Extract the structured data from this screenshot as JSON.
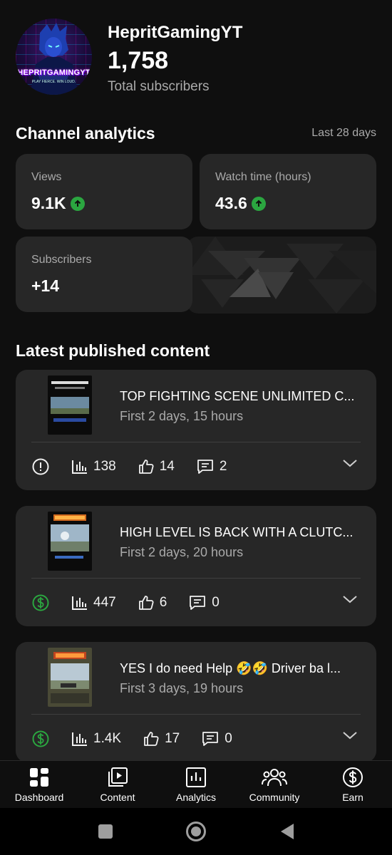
{
  "channel": {
    "avatar_text": "HEPRITGAMINGYT",
    "avatar_tagline": "PLAY FIERCE. WIN LOUD.",
    "name": "HepritGamingYT",
    "subscribers": "1,758",
    "subscribers_label": "Total subscribers"
  },
  "analytics": {
    "title": "Channel analytics",
    "period": "Last 28 days",
    "cards": [
      {
        "label": "Views",
        "value": "9.1K",
        "trend": "up"
      },
      {
        "label": "Watch time (hours)",
        "value": "43.6",
        "trend": "up"
      },
      {
        "label": "Subscribers",
        "value": "+14"
      }
    ]
  },
  "latest": {
    "title": "Latest published content",
    "videos": [
      {
        "title": "TOP FIGHTING SCENE UNLIMITED C...",
        "meta": "First 2 days, 15 hours",
        "status_icon": "alert-icon",
        "views": "138",
        "likes": "14",
        "comments": "2"
      },
      {
        "title": "HIGH LEVEL IS BACK WITH A CLUTC...",
        "meta": "First 2 days, 20 hours",
        "status_icon": "monetized-icon",
        "views": "447",
        "likes": "6",
        "comments": "0"
      },
      {
        "title": "YES I do need Help 🤣🤣 Driver ba l...",
        "meta": "First 3 days, 19 hours",
        "status_icon": "monetized-icon",
        "views": "1.4K",
        "likes": "17",
        "comments": "0"
      }
    ]
  },
  "nav": {
    "items": [
      {
        "label": "Dashboard",
        "icon": "dashboard-icon"
      },
      {
        "label": "Content",
        "icon": "content-icon"
      },
      {
        "label": "Analytics",
        "icon": "analytics-icon"
      },
      {
        "label": "Community",
        "icon": "community-icon"
      },
      {
        "label": "Earn",
        "icon": "earn-icon"
      }
    ]
  },
  "colors": {
    "background": "#0f0f0f",
    "card": "#272727",
    "trend_up": "#2ba640",
    "monetized": "#2ba640",
    "muted_text": "#aaaaaa"
  }
}
